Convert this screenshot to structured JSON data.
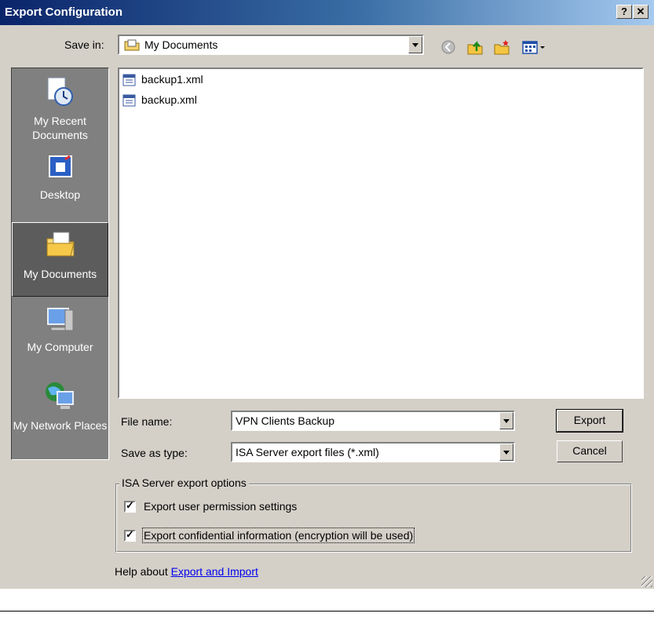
{
  "window": {
    "title": "Export Configuration",
    "help_button": "?",
    "close_button": "✕"
  },
  "save_in": {
    "label": "Save in:",
    "value": "My Documents"
  },
  "places": [
    {
      "label": "My Recent Documents",
      "icon": "recent-documents-icon",
      "selected": false
    },
    {
      "label": "Desktop",
      "icon": "desktop-icon",
      "selected": false
    },
    {
      "label": "My Documents",
      "icon": "my-documents-icon",
      "selected": true
    },
    {
      "label": "My Computer",
      "icon": "my-computer-icon",
      "selected": false
    },
    {
      "label": "My Network Places",
      "icon": "network-places-icon",
      "selected": false
    }
  ],
  "files": [
    {
      "name": "backup1.xml",
      "icon": "xml-file-icon"
    },
    {
      "name": "backup.xml",
      "icon": "xml-file-icon"
    }
  ],
  "file_name": {
    "label": "File name:",
    "value": "VPN Clients Backup"
  },
  "save_as_type": {
    "label": "Save as type:",
    "value": "ISA Server export files (*.xml)"
  },
  "buttons": {
    "export": "Export",
    "cancel": "Cancel"
  },
  "options": {
    "group_label": "ISA Server export options",
    "user_permissions": {
      "label": "Export user permission settings",
      "checked": true
    },
    "confidential": {
      "label": "Export confidential information (encryption will be used)",
      "checked": true
    }
  },
  "help": {
    "text": "Help about ",
    "link": "Export and Import"
  },
  "colors": {
    "title_start": "#0a246a",
    "title_end": "#a6caf0",
    "face": "#d4d0c8",
    "places_bg": "#808080"
  }
}
